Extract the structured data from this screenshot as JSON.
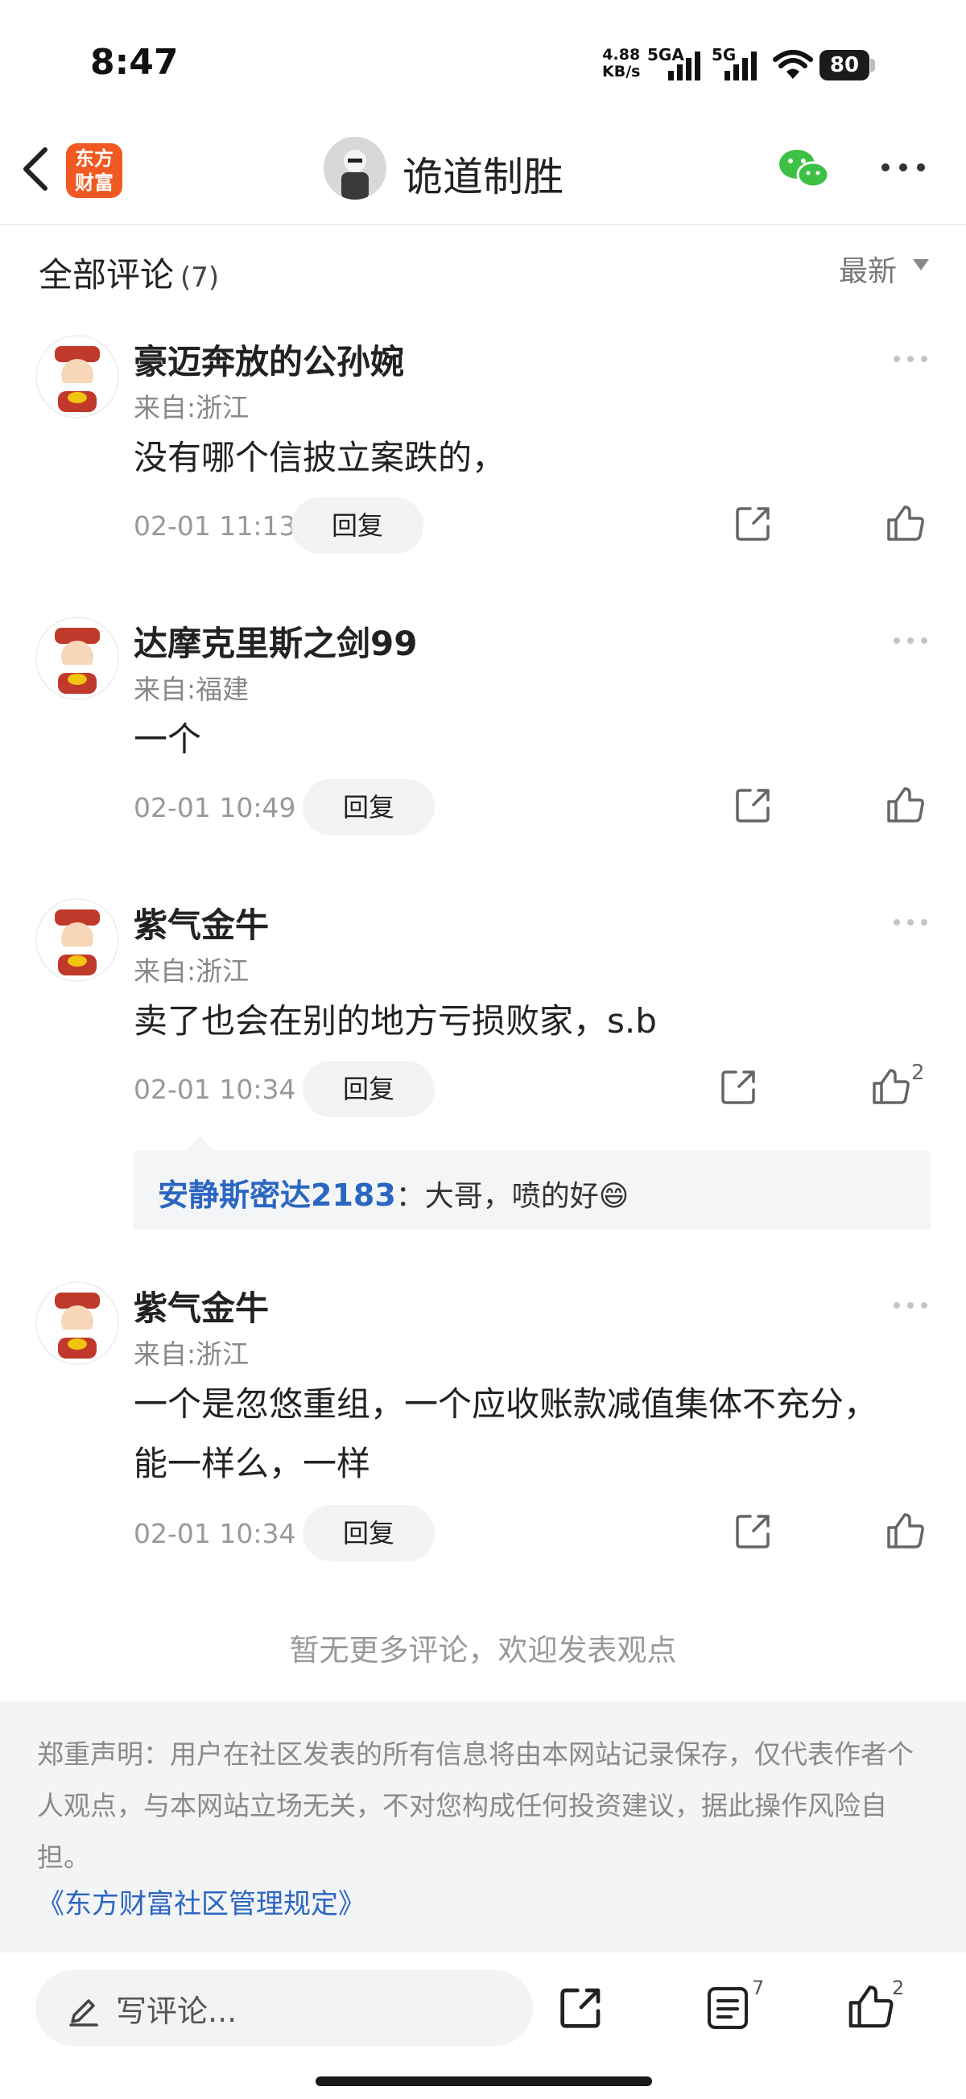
{
  "status_bar": {
    "time": "8:47",
    "speed_value": "4.88",
    "speed_unit": "KB/s",
    "net1": "5GA",
    "net2": "5G",
    "battery": "80"
  },
  "header": {
    "logo_line1": "东方",
    "logo_line2": "财富",
    "title": "诡道制胜",
    "icons": [
      "back-icon",
      "wechat-icon",
      "more-icon"
    ]
  },
  "comments_header": {
    "label": "全部评论",
    "count": "(7)",
    "sort": "最新"
  },
  "comments": [
    {
      "username": "豪迈奔放的公孙婉",
      "location": "来自:浙江",
      "content": "没有哪个信披立案跌的，",
      "content2": "",
      "date": "02-01 11:13",
      "reply": "回复",
      "likes": ""
    },
    {
      "username": "达摩克里斯之剑99",
      "location": "来自:福建",
      "content": "一个",
      "content2": "",
      "date": "02-01 10:49",
      "reply": "回复",
      "likes": ""
    },
    {
      "username": "紫气金牛",
      "location": "来自:浙江",
      "content": "卖了也会在别的地方亏损败家，s.b",
      "content2": "",
      "date": "02-01 10:34",
      "reply": "回复",
      "likes": "2",
      "subreply": {
        "user": "安静斯密达2183",
        "text": "：大哥，喷的好😄"
      }
    },
    {
      "username": "紫气金牛",
      "location": "来自:浙江",
      "content": "一个是忽悠重组，一个应收账款减值集体不充分，",
      "content2": "能一样么，一样",
      "date": "02-01 10:34",
      "reply": "回复",
      "likes": ""
    }
  ],
  "no_more": "暂无更多评论，欢迎发表观点",
  "disclaimer": {
    "text": "郑重声明：用户在社区发表的所有信息将由本网站记录保存，仅代表作者个人观点，与本网站立场无关，不对您构成任何投资建议，据此操作风险自担。",
    "link": "《东方财富社区管理规定》"
  },
  "bottom_bar": {
    "placeholder": "写评论...",
    "comments_count": "7",
    "likes_count": "2"
  },
  "colors": {
    "brand": "#f05a22",
    "link": "#2b66c1",
    "wechat": "#3dc043"
  }
}
